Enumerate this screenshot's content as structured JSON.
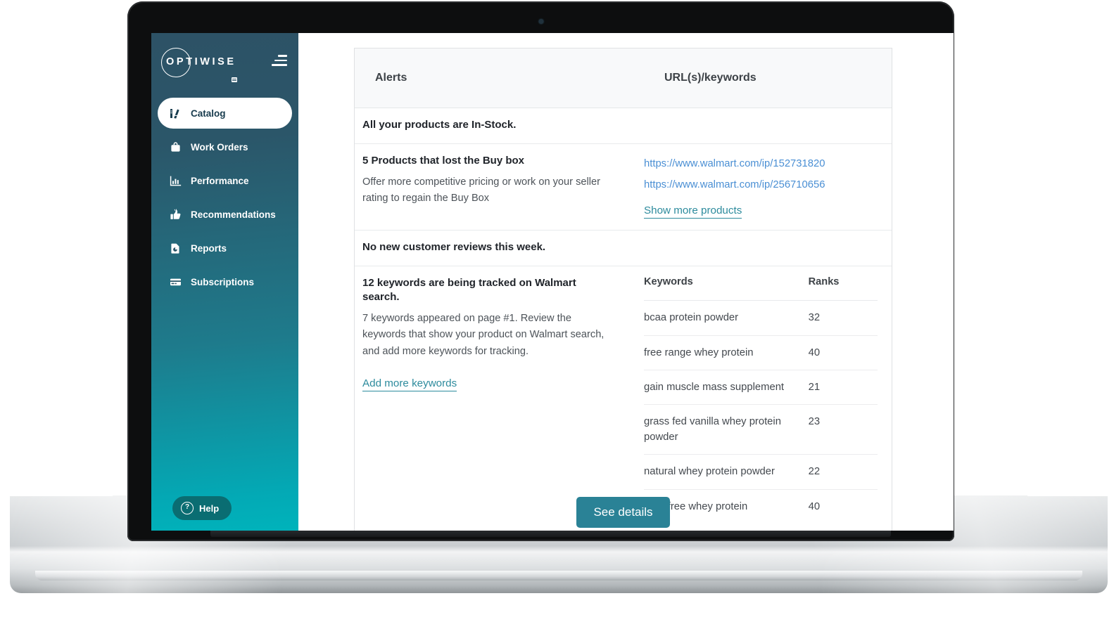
{
  "app": {
    "logo_text": "OPTIWISE"
  },
  "sidebar": {
    "menu_icon": "hamburger-icon",
    "items": [
      {
        "label": "Catalog",
        "icon": "catalog-icon",
        "active": true
      },
      {
        "label": "Work Orders",
        "icon": "briefcase-icon",
        "active": false
      },
      {
        "label": "Performance",
        "icon": "bar-chart-icon",
        "active": false
      },
      {
        "label": "Recommendations",
        "icon": "thumbs-up-icon",
        "active": false
      },
      {
        "label": "Reports",
        "icon": "document-icon",
        "active": false
      },
      {
        "label": "Subscriptions",
        "icon": "credit-card-icon",
        "active": false
      }
    ],
    "help": {
      "label": "Help",
      "icon": "question-circle-icon",
      "symbol": "?"
    }
  },
  "table": {
    "headers": {
      "alerts": "Alerts",
      "urls": "URL(s)/keywords"
    },
    "rows": [
      {
        "title": "All your products are In-Stock.",
        "description": "",
        "links": []
      },
      {
        "title": "5 Products that lost the Buy box",
        "description": "Offer more competitive pricing or work on your seller rating to regain the Buy Box",
        "links": [
          "https://www.walmart.com/ip/152731820",
          "https://www.walmart.com/ip/256710656"
        ],
        "action_link": "Show more products"
      },
      {
        "title": "No new customer reviews this week.",
        "description": "",
        "links": []
      },
      {
        "title": "12 keywords are being tracked on Walmart search.",
        "description": "7 keywords appeared on page #1. Review the keywords that show your product on Walmart search, and add more keywords for tracking.",
        "action_link": "Add more keywords"
      }
    ]
  },
  "keywords_table": {
    "headers": {
      "keyword": "Keywords",
      "rank": "Ranks"
    },
    "rows": [
      {
        "keyword": "bcaa protein powder",
        "rank": "32"
      },
      {
        "keyword": "free range whey protein",
        "rank": "40"
      },
      {
        "keyword": "gain muscle mass supplement",
        "rank": "21"
      },
      {
        "keyword": "grass fed vanilla whey protein powder",
        "rank": "23"
      },
      {
        "keyword": "natural whey protein powder",
        "rank": "22"
      },
      {
        "keyword": "rbgh free whey protein",
        "rank": "40"
      }
    ]
  },
  "footer": {
    "see_details_label": "See details"
  },
  "colors": {
    "sidebar_top": "#2d5266",
    "sidebar_bottom": "#00b3bb",
    "link_blue": "#4a8fd4",
    "link_teal": "#2d8b9d",
    "button_teal": "#2a8296",
    "help_teal": "#0a6d72"
  }
}
